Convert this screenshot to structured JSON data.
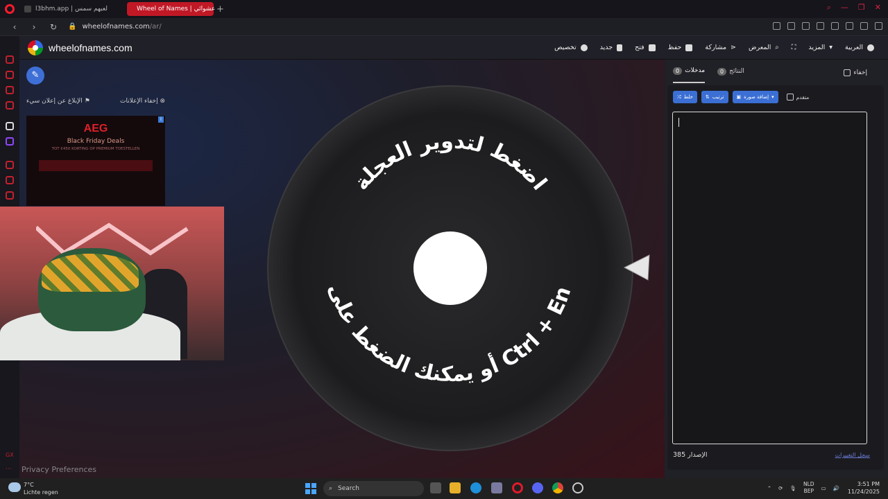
{
  "browser": {
    "tabs": [
      {
        "label": "l3bhm.app | لعبهم سمس"
      },
      {
        "label": "Wheel of Names | عشوائي"
      }
    ],
    "new_tab": "+",
    "url_host": "wheelofnames.com",
    "url_path": "/ar/"
  },
  "site": {
    "name": "wheelofnames.com",
    "menu": [
      {
        "label": "العربية",
        "icon": "globe-icon"
      },
      {
        "label": "المزيد",
        "icon": "chevron-down-icon"
      },
      {
        "label": "",
        "icon": "fullscreen-icon"
      },
      {
        "label": "المعرض",
        "icon": "search-icon"
      },
      {
        "label": "مشاركة",
        "icon": "share-icon"
      },
      {
        "label": "حفظ",
        "icon": "save-icon"
      },
      {
        "label": "فتح",
        "icon": "folder-icon"
      },
      {
        "label": "جديد",
        "icon": "file-icon"
      },
      {
        "label": "تخصيص",
        "icon": "palette-icon"
      }
    ]
  },
  "ad": {
    "hide_ads": "إخفاء الإعلانات",
    "report_ad": "الإبلاغ عن إعلان سيء",
    "brand": "AEG",
    "headline": "Black Friday Deals",
    "fine_print": "TOT €450 KORTING OP PREMIUM TOESTELLEN"
  },
  "wheel": {
    "top_text": "اضغط لتدوير العجلة",
    "bottom_text": "أو يمكنك الضغط على زر Ctrl + Enter"
  },
  "panel": {
    "hide_label": "إخفاء",
    "tabs": [
      {
        "label": "مدخلات",
        "count": "0"
      },
      {
        "label": "النتائج",
        "count": "0"
      }
    ],
    "shuffle": "خلط",
    "sort": "ترتيب",
    "add_image": "إضافة صورة",
    "advanced": "متقدم",
    "version_label": "الإصدار 385",
    "changelog": "سجل التغييرات"
  },
  "footer": {
    "privacy": "Privacy Preferences"
  },
  "taskbar": {
    "temp": "7°C",
    "weather": "Lichte regen",
    "search": "Search",
    "lang": "NLD",
    "lang2": "BEP",
    "time": "3:51 PM",
    "date": "11/24/2025"
  },
  "colors": {
    "accent_red": "#c11826",
    "button_blue": "#3b6fd4"
  }
}
